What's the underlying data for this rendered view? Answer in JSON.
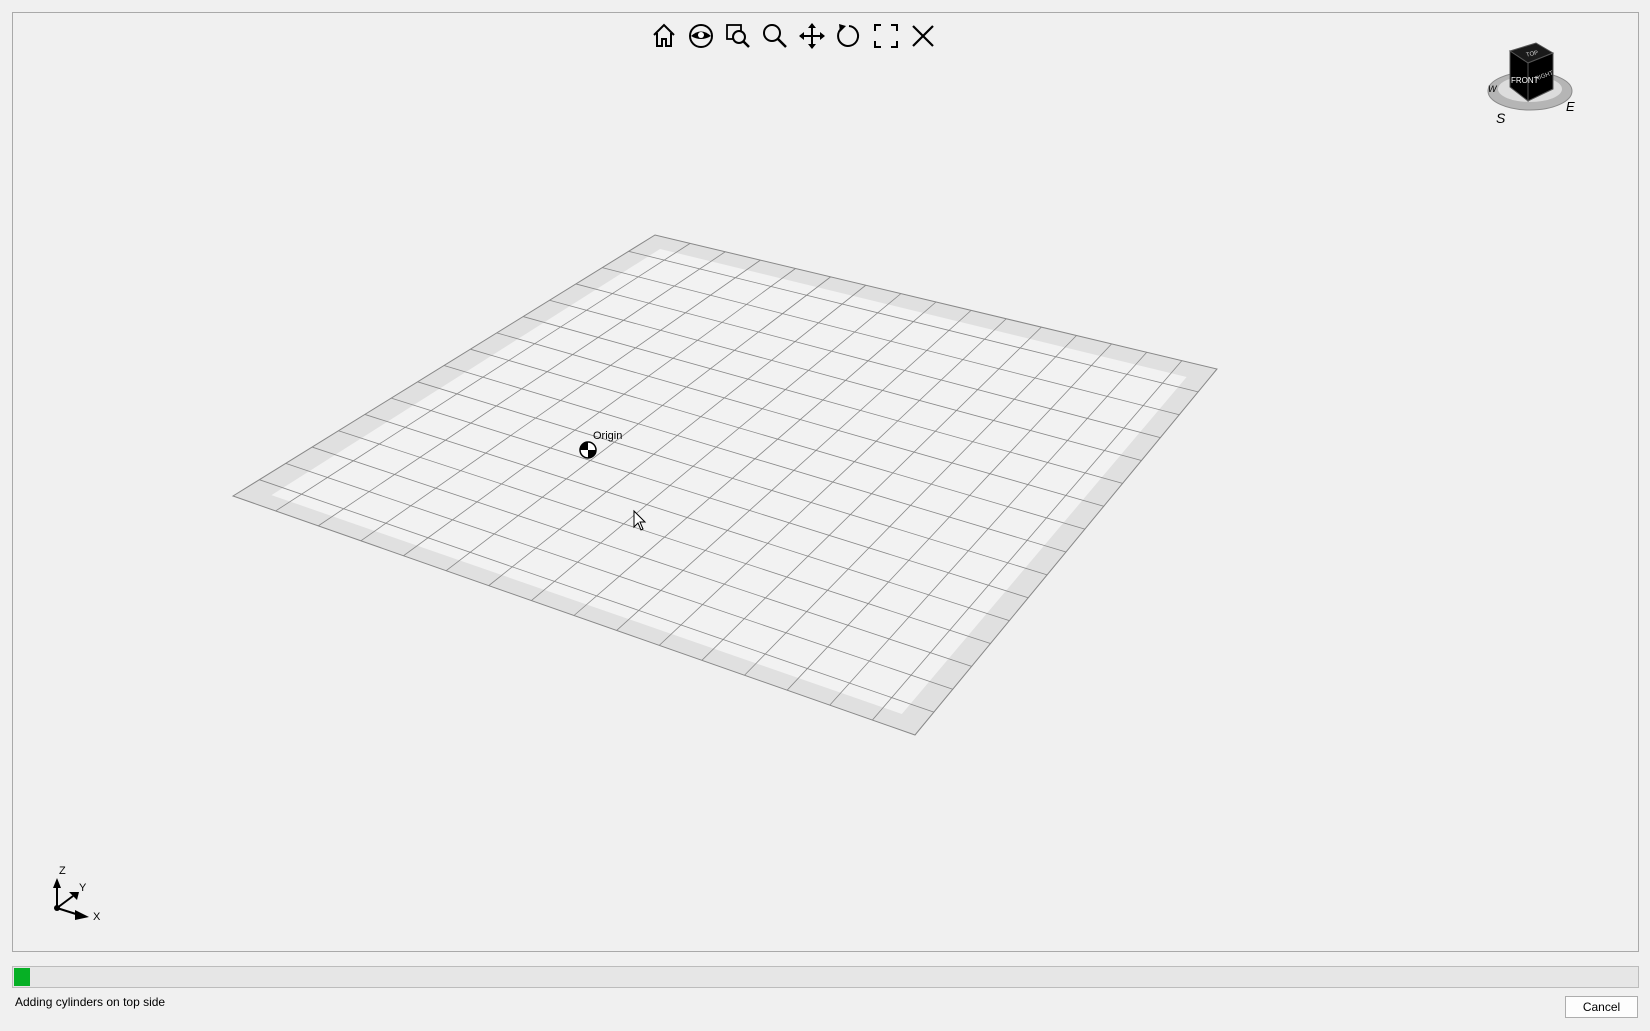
{
  "viewport": {
    "origin_label": "Origin",
    "axis_triad": {
      "x": "X",
      "y": "Y",
      "z": "Z"
    },
    "view_cube": {
      "faces": {
        "top": "TOP",
        "front": "FRONT",
        "right": "RIGHT"
      },
      "compass": {
        "south": "S",
        "east": "E",
        "west": "W"
      }
    }
  },
  "toolbar": {
    "icons": [
      "home-icon",
      "look-at-icon",
      "zoom-window-icon",
      "zoom-icon",
      "pan-icon",
      "rotate-icon",
      "fit-all-icon",
      "close-icon"
    ]
  },
  "progress": {
    "value": 0.01,
    "color": "#06b025"
  },
  "status": {
    "text": "Adding cylinders on top side"
  },
  "actions": {
    "cancel_label": "Cancel"
  },
  "colors": {
    "background": "#f0f0f0",
    "grid_fill": "#f2f2f2",
    "grid_border": "#e0e0e0",
    "grid_line": "#888888"
  }
}
